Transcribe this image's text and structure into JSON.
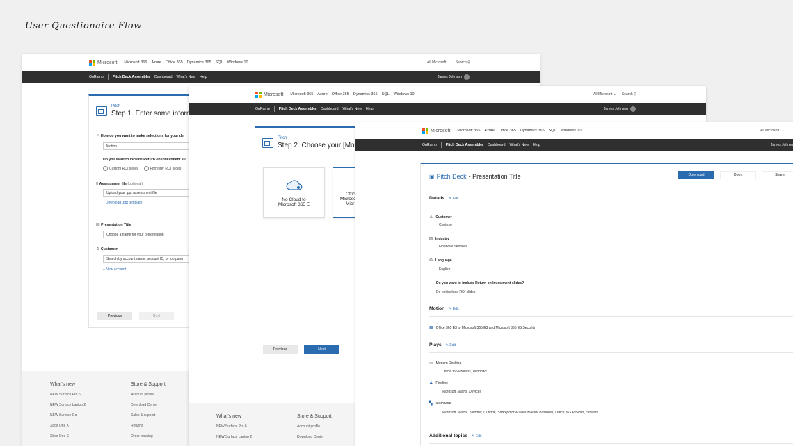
{
  "page": {
    "flow_title": "User Questionaire Flow"
  },
  "header": {
    "brand": "Microsoft",
    "nav": [
      "Microsoft 365",
      "Azure",
      "Office 365",
      "Dynamics 365",
      "SQL",
      "Windows 10"
    ],
    "all_microsoft": "All Microsoft",
    "search": "Search"
  },
  "subnav": {
    "items": [
      "OnRamp",
      "Pitch Deck Assembler",
      "Dashboard",
      "What's New",
      "Help"
    ],
    "user": "James Johnson"
  },
  "step1": {
    "pitch": "Pitch",
    "title": "Step 1. Enter some informa",
    "q1": "How do you want to make selections for your de",
    "q1_value": "Motion",
    "q2": "Do you want to include Return on Investment sli",
    "radio1": "Custom ROI slides",
    "radio2": "Forrester ROI slides",
    "assessment_label": "Assessment file",
    "assessment_optional": "(optional)",
    "assessment_value": "Upload your .ppt assessment file",
    "download_template": "Download .ppt template",
    "pres_title_label": "Presentation Title",
    "pres_title_placeholder": "Choose a name for your presentation",
    "customer_label": "Customer",
    "customer_placeholder": "Search by account name, account ID, or top paren",
    "new_account": "+ New account",
    "prev": "Previous",
    "next": "Next"
  },
  "step2": {
    "pitch": "Pitch",
    "title": "Step 2. Choose your [Motio",
    "tile1_line1": "No Cloud to",
    "tile1_line2": "Microsoft 365 E",
    "tile2_line1": "Offic",
    "tile2_line2": "Microso",
    "tile2_line3": "Micr",
    "prev": "Previous",
    "next": "Next"
  },
  "footer": {
    "col1_title": "What's new",
    "col1_items": [
      "NEW Surface Pro 6",
      "NEW Surface Laptop 2",
      "NEW Surface Go",
      "Xbox One X",
      "Xbox One S"
    ],
    "col2_title": "Store & Support",
    "col2_items": [
      "Account profile",
      "Download Center",
      "Sales & support",
      "Returns",
      "Order tracking"
    ]
  },
  "summary": {
    "title_blue": "Pitch Deck",
    "title_rest": "- Presentation Title",
    "download": "Download",
    "open": "Open",
    "share": "Share",
    "details": "Details",
    "edit": "Edit",
    "customer_label": "Customer",
    "customer_value": "Contoso",
    "industry_label": "Industry",
    "industry_value": "Financial Services",
    "language_label": "Language",
    "language_value": "English",
    "roi_question": "Do you want to include Return on Investment slides?",
    "roi_value": "Do not include ROI slides",
    "motion": "Motion",
    "motion_value": "Office 365 E3 to Microsoft 365 E3 and Microsoft 365 E5 Security",
    "plays": "Plays",
    "play1": "Modern Desktop",
    "play1_value": "Office 365 ProPlus, Windows",
    "play2": "Firstline",
    "play2_value": "Microsoft Teams, Devices",
    "play3": "Teamwork",
    "play3_value": "Microsoft Teams, Yammer, Outlook, Sharepoint & OneDrive for Business, Office 365 ProPlus, Stream",
    "additional": "Additional topics"
  }
}
